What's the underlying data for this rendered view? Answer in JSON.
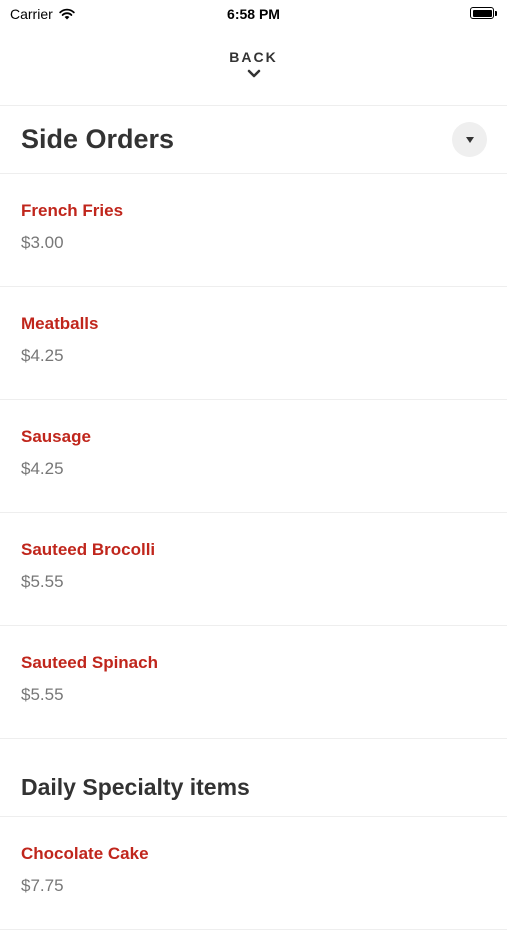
{
  "status_bar": {
    "carrier": "Carrier",
    "time": "6:58 PM"
  },
  "back": {
    "label": "BACK"
  },
  "section": {
    "title": "Side Orders"
  },
  "items": [
    {
      "name": "French Fries",
      "price": "$3.00"
    },
    {
      "name": "Meatballs",
      "price": "$4.25"
    },
    {
      "name": "Sausage",
      "price": "$4.25"
    },
    {
      "name": "Sauteed Brocolli",
      "price": "$5.55"
    },
    {
      "name": "Sauteed Spinach",
      "price": "$5.55"
    }
  ],
  "subsection": {
    "title": "Daily Specialty items"
  },
  "special_items": [
    {
      "name": "Chocolate Cake",
      "price": "$7.75"
    }
  ],
  "colors": {
    "accent": "#c0261c",
    "price": "#777777",
    "divider": "#eeeeee"
  }
}
